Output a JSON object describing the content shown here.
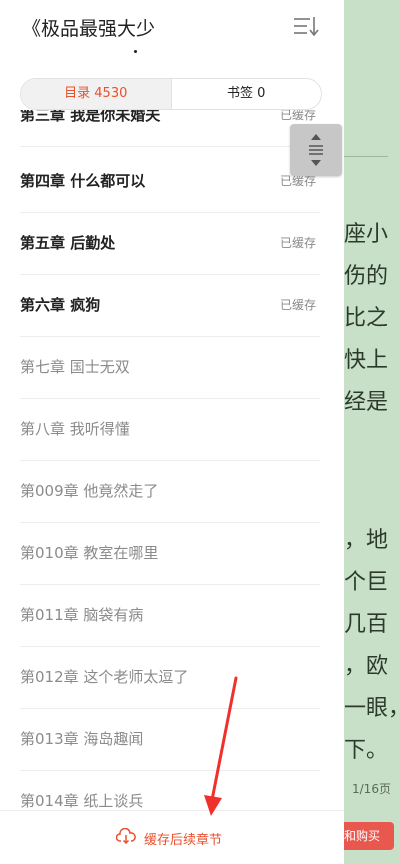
{
  "header": {
    "book_title": "《极品最强大少"
  },
  "tabs": [
    {
      "label": "目录 4530",
      "active": true
    },
    {
      "label": "书签 0",
      "active": false
    }
  ],
  "chapters": [
    {
      "title": "第三章 我是你未婚夫",
      "status": "已缓存",
      "cached": true
    },
    {
      "title": "第四章 什么都可以",
      "status": "已缓存",
      "cached": true
    },
    {
      "title": "第五章 后勤处",
      "status": "已缓存",
      "cached": true
    },
    {
      "title": "第六章 疯狗",
      "status": "已缓存",
      "cached": true
    },
    {
      "title": "第七章 国士无双",
      "status": "",
      "cached": false
    },
    {
      "title": "第八章 我听得懂",
      "status": "",
      "cached": false
    },
    {
      "title": "第009章 他竟然走了",
      "status": "",
      "cached": false
    },
    {
      "title": "第010章 教室在哪里",
      "status": "",
      "cached": false
    },
    {
      "title": "第011章 脑袋有病",
      "status": "",
      "cached": false
    },
    {
      "title": "第012章 这个老师太逗了",
      "status": "",
      "cached": false
    },
    {
      "title": "第013章 海岛趣闻",
      "status": "",
      "cached": false
    },
    {
      "title": "第014章 纸上谈兵",
      "status": "",
      "cached": false
    }
  ],
  "footer": {
    "cache_button": "缓存后续章节"
  },
  "reader": {
    "lines": [
      "座小",
      "伤的",
      "比之",
      "快上",
      "经是",
      "，地",
      "个巨",
      "几百",
      "，欧",
      "一眼，",
      "下。"
    ],
    "page_info": "1/16页",
    "buy_label": "和购买"
  },
  "colors": {
    "accent": "#e8502e",
    "reader_bg": "#c8dfc8",
    "annotation_arrow": "#f0302a"
  },
  "icons": {
    "sort": "sort-list-icon",
    "scroll": "scroll-grip-icon",
    "cloud": "cloud-download-icon"
  }
}
